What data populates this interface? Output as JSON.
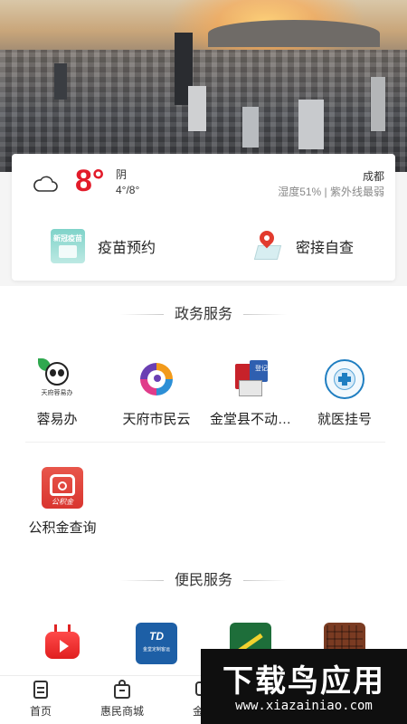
{
  "weather": {
    "temperature": "8°",
    "condition": "阴",
    "range": "4°/8°",
    "city": "成都",
    "details": "湿度51% | 紫外线最弱"
  },
  "quick_actions": [
    {
      "label": "疫苗预约",
      "icon": "vaccine-icon",
      "icon_text": "新冠疫苗"
    },
    {
      "label": "密接自查",
      "icon": "map-pin-icon"
    }
  ],
  "sections": {
    "government": {
      "title": "政务服务",
      "items": [
        {
          "label": "蓉易办",
          "icon": "panda-icon",
          "icon_text": "天府蓉易办"
        },
        {
          "label": "天府市民云",
          "icon": "citizen-cloud-icon"
        },
        {
          "label": "金堂县不动…",
          "icon": "real-estate-icon",
          "icon_text": "登记"
        },
        {
          "label": "就医挂号",
          "icon": "hospital-icon"
        },
        {
          "label": "公积金查询",
          "icon": "housing-fund-icon",
          "icon_text": "公积金"
        }
      ]
    },
    "convenience": {
      "title": "便民服务",
      "items": [
        {
          "icon": "tv-icon"
        },
        {
          "icon": "td-icon",
          "icon_text": "TD",
          "icon_subtext": "金堂定制客运"
        },
        {
          "icon": "green-app-icon"
        },
        {
          "icon": "brown-app-icon"
        }
      ]
    }
  },
  "tabbar": {
    "tabs": [
      {
        "label": "首页",
        "icon": "home-icon"
      },
      {
        "label": "惠民商城",
        "icon": "shopping-bag-icon"
      },
      {
        "label": "金…",
        "icon": "chat-icon"
      }
    ]
  },
  "watermark": {
    "title": "下载鸟应用",
    "url": "www.xiazainiao.com"
  },
  "colors": {
    "accent_red": "#e21b2a",
    "watermark_green": "#8bd12a"
  }
}
